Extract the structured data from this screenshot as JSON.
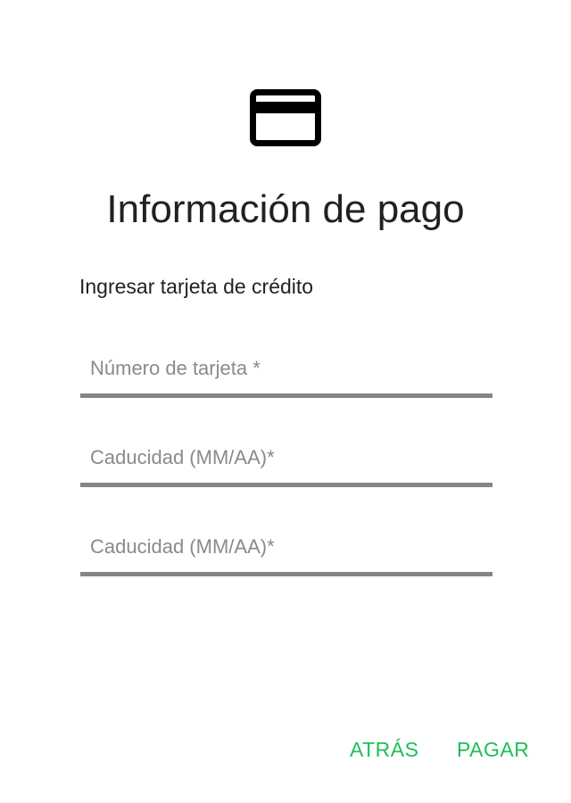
{
  "colors": {
    "accent": "#1dbf58",
    "icon": "#000000",
    "underline": "#858585",
    "placeholder": "#8a8a8a"
  },
  "header": {
    "icon": "credit-card-icon",
    "title": "Información de pago",
    "subtitle": "Ingresar tarjeta de crédito"
  },
  "form": {
    "fields": [
      {
        "placeholder": "Número de tarjeta *",
        "value": ""
      },
      {
        "placeholder": "Caducidad (MM/AA)*",
        "value": ""
      },
      {
        "placeholder": "Caducidad (MM/AA)*",
        "value": ""
      }
    ]
  },
  "actions": {
    "back_label": "ATRÁS",
    "pay_label": "PAGAR"
  }
}
